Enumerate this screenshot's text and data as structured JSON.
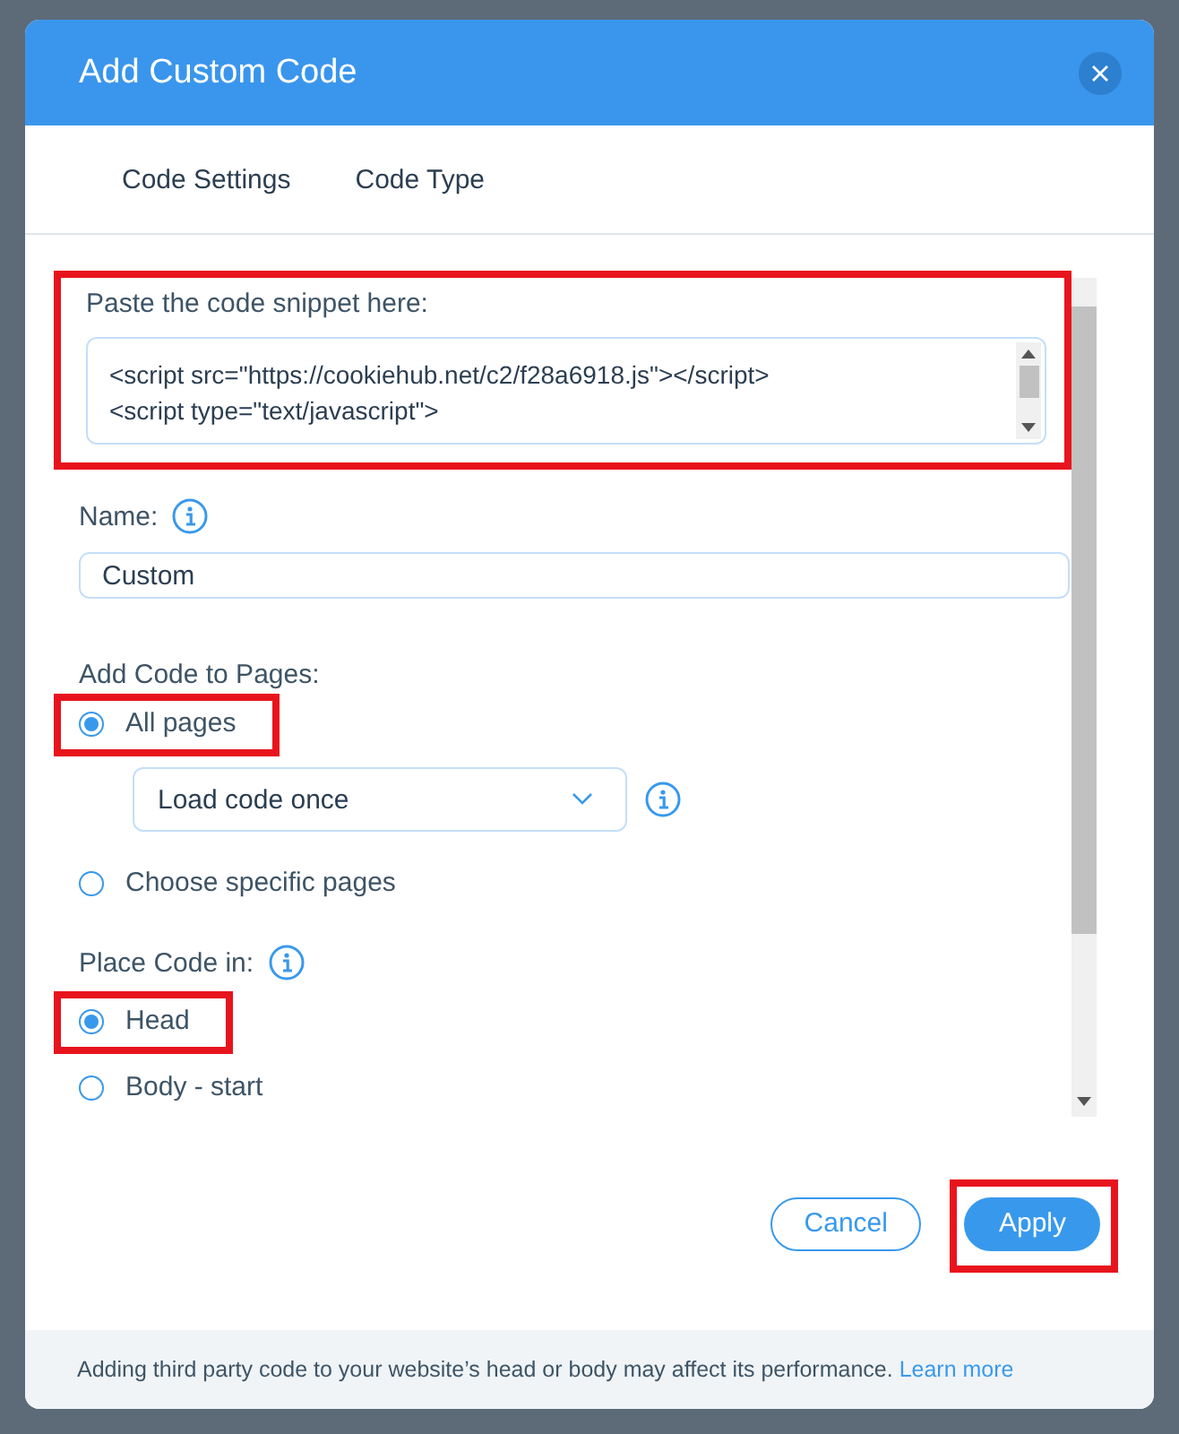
{
  "dialog": {
    "title": "Add Custom Code"
  },
  "tabs": [
    {
      "label": "Code Settings"
    },
    {
      "label": "Code Type"
    }
  ],
  "snippet": {
    "label": "Paste the code snippet here:",
    "highlighted": true,
    "lines": [
      "<script src=\"https://cookiehub.net/c2/f28a6918.js\"></script>",
      "<script type=\"text/javascript\">"
    ]
  },
  "name": {
    "label": "Name:",
    "value": "Custom"
  },
  "pages": {
    "label": "Add Code to Pages:",
    "options": [
      {
        "label": "All pages",
        "selected": true,
        "highlighted": true,
        "dropdown": "Load code once"
      },
      {
        "label": "Choose specific pages",
        "selected": false,
        "highlighted": false
      }
    ]
  },
  "placement": {
    "label": "Place Code in:",
    "options": [
      {
        "label": "Head",
        "selected": true,
        "highlighted": true
      },
      {
        "label": "Body - start",
        "selected": false,
        "highlighted": false
      }
    ]
  },
  "buttons": [
    {
      "label": "Cancel",
      "kind": "secondary",
      "highlighted": false
    },
    {
      "label": "Apply",
      "kind": "primary",
      "highlighted": true
    }
  ],
  "notice": {
    "text": "Adding third party code to your website’s head or body may affect its performance.",
    "link": "Learn more"
  }
}
